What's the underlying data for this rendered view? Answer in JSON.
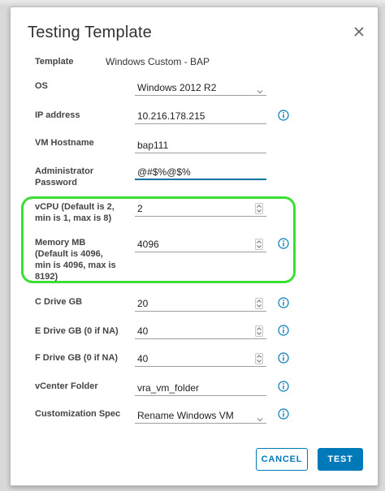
{
  "dialog": {
    "title": "Testing Template",
    "close_icon": "close-icon"
  },
  "form": {
    "template": {
      "label": "Template",
      "value": "Windows Custom - BAP"
    },
    "os": {
      "label": "OS",
      "value": "Windows 2012 R2"
    },
    "ip_address": {
      "label": "IP address",
      "value": "10.216.178.215"
    },
    "vm_hostname": {
      "label": "VM Hostname",
      "value": "bap111"
    },
    "admin_password": {
      "label_line1": "Administrator",
      "label_line2": "Password",
      "value": "@#$%@$%"
    },
    "vcpu": {
      "label_line1": "vCPU (Default is 2,",
      "label_line2": "min is 1, max is 8)",
      "value": "2"
    },
    "memory": {
      "label_line1": "Memory MB",
      "label_line2": "(Default is 4096,",
      "label_line3": "min is 4096, max is",
      "label_line4": "8192)",
      "value": "4096"
    },
    "c_drive": {
      "label": "C Drive GB",
      "value": "20"
    },
    "e_drive": {
      "label": "E Drive GB (0 if NA)",
      "value": "40"
    },
    "f_drive": {
      "label": "F Drive GB (0 if NA)",
      "value": "40"
    },
    "vcenter_folder": {
      "label": "vCenter Folder",
      "value": "vra_vm_folder"
    },
    "customization_spec": {
      "label": "Customization Spec",
      "value": "Rename Windows VM"
    }
  },
  "buttons": {
    "cancel": "CANCEL",
    "test": "TEST"
  },
  "colors": {
    "accent": "#0079b8",
    "highlight": "#39e031"
  }
}
